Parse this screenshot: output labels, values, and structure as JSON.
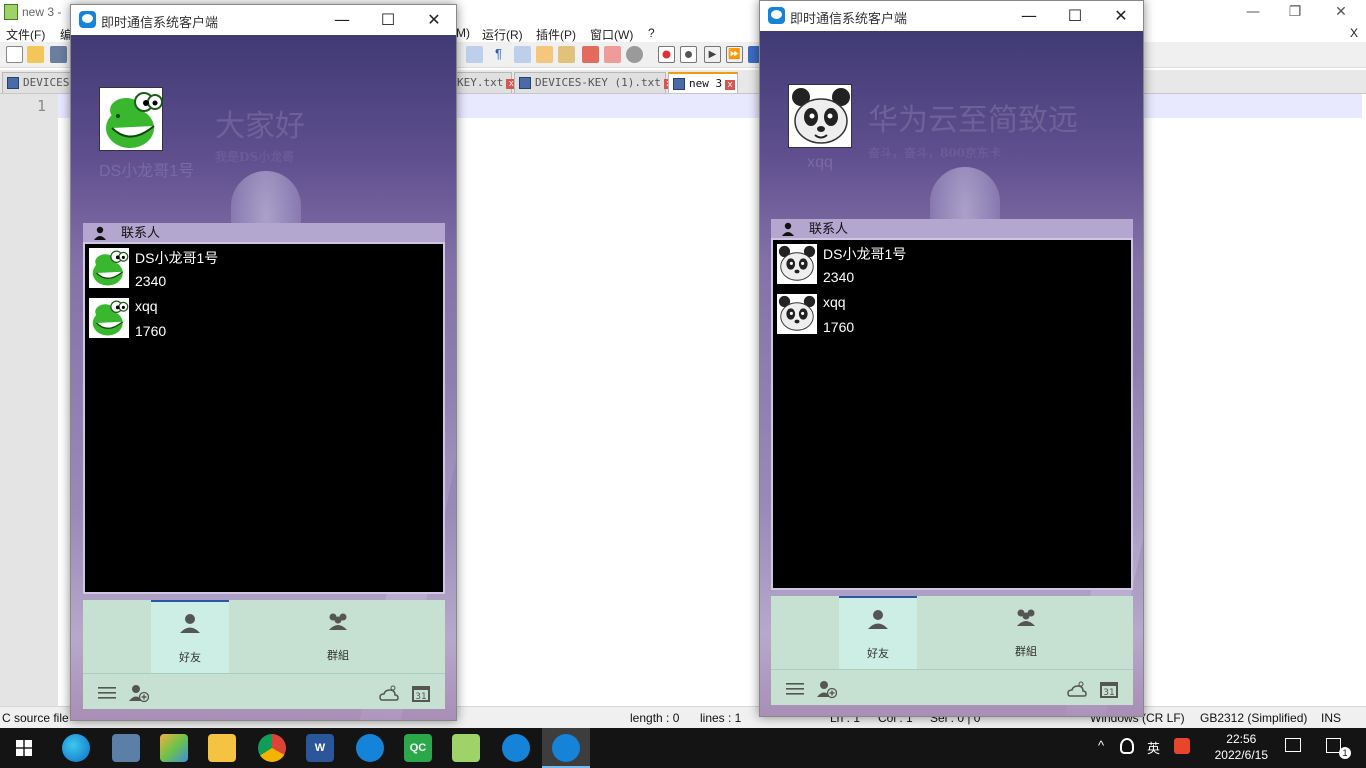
{
  "npp": {
    "title": "new 3 -",
    "menus": [
      "文件(F)",
      "编",
      "M)",
      "运行(R)",
      "插件(P)",
      "窗口(W)",
      "?"
    ],
    "tabs": [
      "DEVICES-",
      "KEY.txt",
      "DEVICES-KEY (1).txt",
      "new 3"
    ],
    "line_number": "1",
    "status": {
      "file_type": "C source file",
      "length": "length : 0",
      "lines": "lines : 1",
      "ln": "Ln : 1",
      "col": "Col : 1",
      "sel": "Sel : 0 | 0",
      "eol": "Windows (CR LF)",
      "encoding": "GB2312 (Simplified)",
      "mode": "INS"
    },
    "close_x": "X"
  },
  "im_left": {
    "title": "即时通信系统客户端",
    "nickname": "DS小龙哥1号",
    "slogan": "大家好",
    "signature": "我是DS小龙哥",
    "contacts_header": "联系人",
    "contacts": [
      {
        "name": "DS小龙哥1号",
        "score": "2340"
      },
      {
        "name": "xqq",
        "score": "1760"
      }
    ],
    "tabs": {
      "friends": "好友",
      "groups": "群組"
    },
    "avatar": "green-dinosaur"
  },
  "im_right": {
    "title": "即时通信系统客户端",
    "nickname": "xqq",
    "slogan": "华为云至简致远",
    "signature": "奋斗，奋斗，800京东卡",
    "contacts_header": "联系人",
    "contacts": [
      {
        "name": "DS小龙哥1号",
        "score": "2340"
      },
      {
        "name": "xqq",
        "score": "1760"
      }
    ],
    "tabs": {
      "friends": "好友",
      "groups": "群組"
    },
    "avatar": "panda"
  },
  "taskbar": {
    "time": "22:56",
    "date": "2022/6/15",
    "ime": "英",
    "notification_count": "1",
    "apps": [
      "word-icon",
      "qc-icon"
    ]
  },
  "colors": {
    "accent": "#2d57a3",
    "panel": "#c6e0d2",
    "purple_bg": "#6a5c93"
  }
}
